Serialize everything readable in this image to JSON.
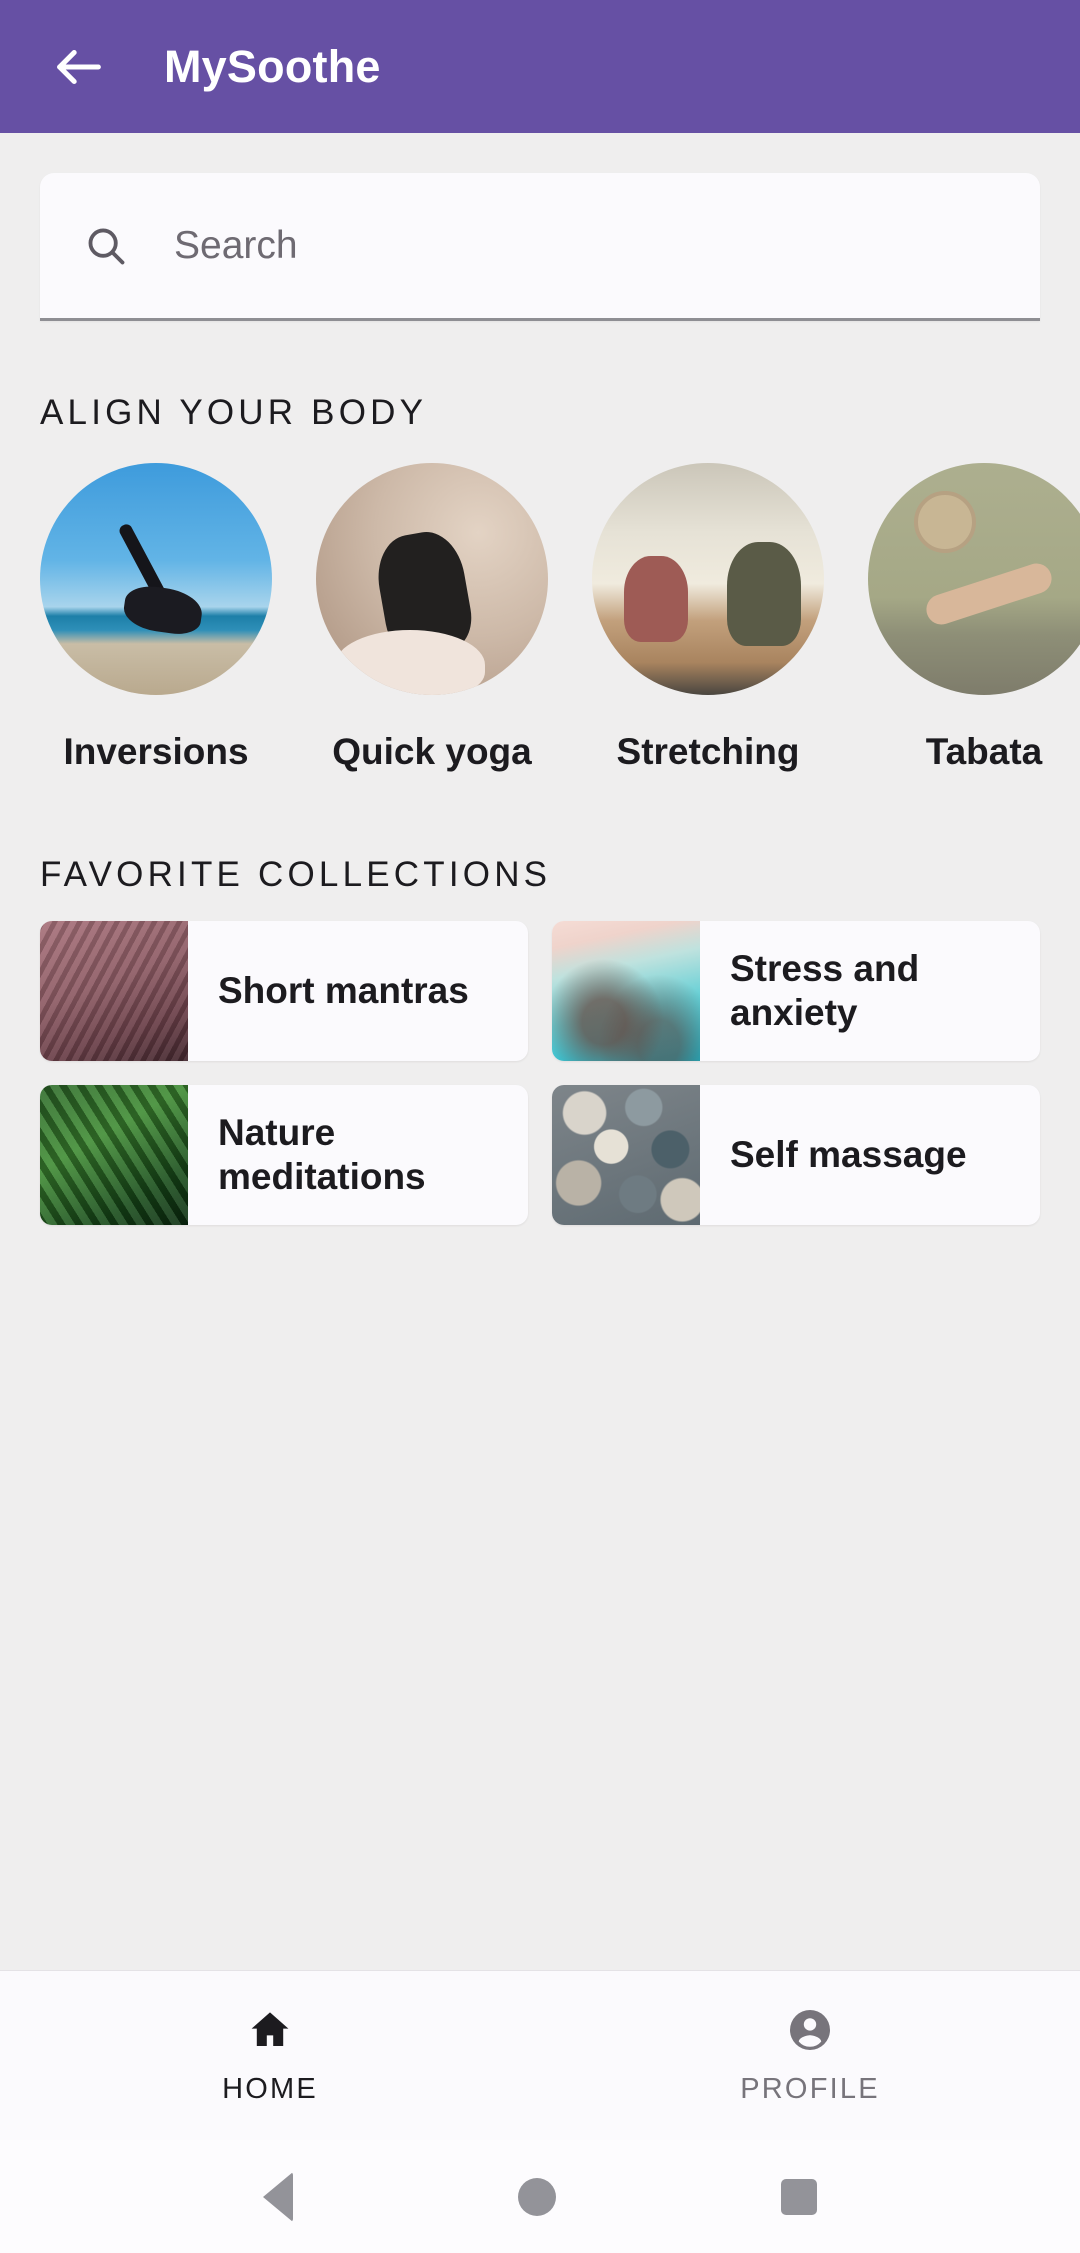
{
  "app": {
    "title": "MySoothe",
    "header_color": "#6650A4",
    "background_color": "#EFEEEE",
    "back_icon": "arrow-left-icon"
  },
  "search": {
    "placeholder": "Search",
    "value": "",
    "icon": "search-icon"
  },
  "sections": {
    "align": {
      "title": "ALIGN YOUR BODY",
      "items": [
        {
          "label": "Inversions",
          "art": "art-inversions"
        },
        {
          "label": "Quick yoga",
          "art": "art-quickyoga"
        },
        {
          "label": "Stretching",
          "art": "art-stretching"
        },
        {
          "label": "Tabata",
          "art": "art-tabata"
        },
        {
          "label": "",
          "art": "art-peek"
        }
      ]
    },
    "favorites": {
      "title": "FAVORITE COLLECTIONS",
      "items": [
        {
          "label": "Short mantras",
          "art": "th-mantras"
        },
        {
          "label": "Stress and anxiety",
          "art": "th-stress"
        },
        {
          "label": "Nature meditations",
          "art": "th-nature"
        },
        {
          "label": "Self massage",
          "art": "th-pebbles"
        }
      ]
    }
  },
  "bottom_nav": {
    "items": [
      {
        "label": "HOME",
        "icon": "home-icon",
        "active": true
      },
      {
        "label": "PROFILE",
        "icon": "account-circle-icon",
        "active": false
      }
    ]
  },
  "system_nav": {
    "back": "triangle-back-icon",
    "home": "circle-home-icon",
    "recents": "square-recents-icon"
  }
}
